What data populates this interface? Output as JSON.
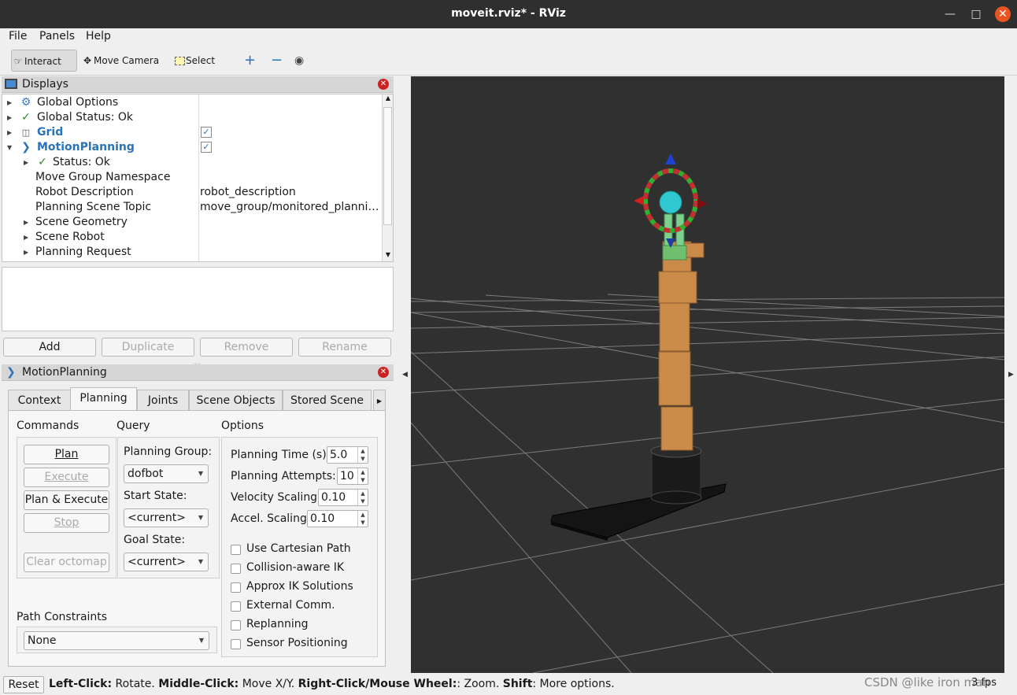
{
  "window": {
    "title": "moveit.rviz* - RViz"
  },
  "menu": [
    "File",
    "Panels",
    "Help"
  ],
  "toolbar": {
    "interact": "Interact",
    "move_camera": "Move Camera",
    "select": "Select"
  },
  "displays": {
    "header": "Displays",
    "rows": [
      {
        "label": "Global Options",
        "value": ""
      },
      {
        "label": "Global Status: Ok",
        "value": ""
      },
      {
        "label": "Grid",
        "value": ""
      },
      {
        "label": "MotionPlanning",
        "value": ""
      },
      {
        "label": "Status: Ok",
        "value": ""
      },
      {
        "label": "Move Group Namespace",
        "value": ""
      },
      {
        "label": "Robot Description",
        "value": "robot_description"
      },
      {
        "label": "Planning Scene Topic",
        "value": "move_group/monitored_planni…"
      },
      {
        "label": "Scene Geometry",
        "value": ""
      },
      {
        "label": "Scene Robot",
        "value": ""
      },
      {
        "label": "Planning Request",
        "value": ""
      }
    ],
    "buttons": {
      "add": "Add",
      "duplicate": "Duplicate",
      "remove": "Remove",
      "rename": "Rename"
    }
  },
  "motion_panel": {
    "header": "MotionPlanning",
    "tabs": [
      "Context",
      "Planning",
      "Joints",
      "Scene Objects",
      "Stored Scene"
    ],
    "commands": {
      "title": "Commands",
      "plan": "Plan",
      "execute": "Execute",
      "plan_execute": "Plan & Execute",
      "stop": "Stop",
      "clear_octomap": "Clear octomap"
    },
    "query": {
      "title": "Query",
      "planning_group_label": "Planning Group:",
      "planning_group": "dofbot",
      "start_state_label": "Start State:",
      "start_state": "<current>",
      "goal_state_label": "Goal State:",
      "goal_state": "<current>"
    },
    "options": {
      "title": "Options",
      "planning_time_label": "Planning Time (s):",
      "planning_time": "5.0",
      "planning_attempts_label": "Planning Attempts:",
      "planning_attempts": "10",
      "velocity_label": "Velocity Scaling:",
      "velocity": "0.10",
      "accel_label": "Accel. Scaling:",
      "accel": "0.10",
      "checkboxes": [
        "Use Cartesian Path",
        "Collision-aware IK",
        "Approx IK Solutions",
        "External Comm.",
        "Replanning",
        "Sensor Positioning"
      ]
    },
    "path_constraints": {
      "title": "Path Constraints",
      "value": "None"
    }
  },
  "status": {
    "reset": "Reset",
    "k1": "Left-Click:",
    "t1": " Rotate. ",
    "k2": "Middle-Click:",
    "t2": " Move X/Y. ",
    "k3": "Right-Click/Mouse Wheel:",
    "t3": ": Zoom. ",
    "k4": "Shift",
    "t4": ": More options.",
    "watermark": "CSDN @like iron man",
    "fps": "3 fps"
  }
}
